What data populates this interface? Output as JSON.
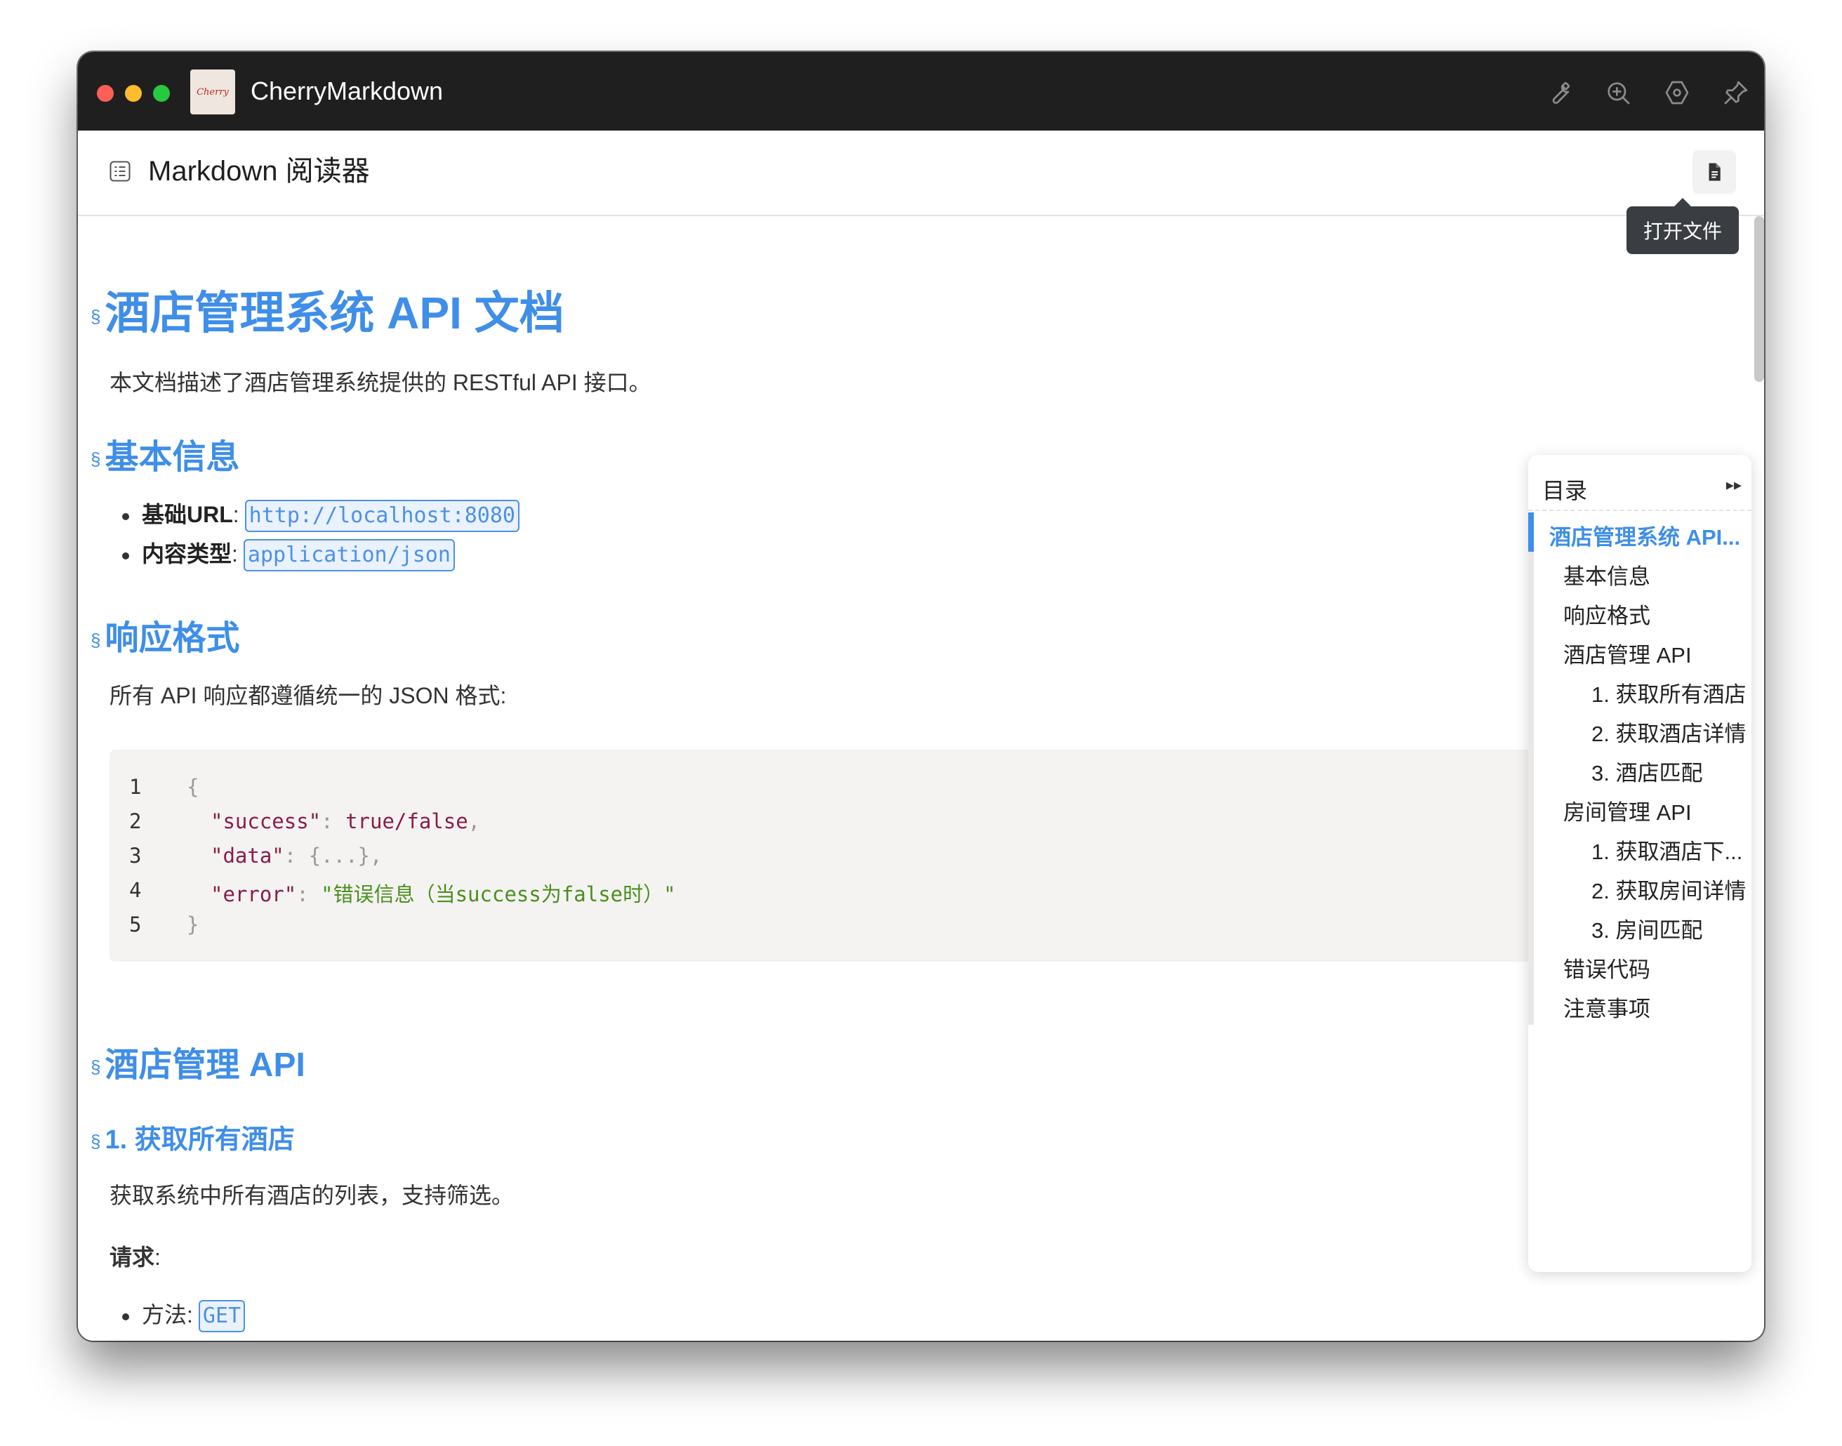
{
  "window": {
    "app_title": "CherryMarkdown",
    "app_icon_text": "Cherry"
  },
  "titlebar_icons": [
    "wrench-icon",
    "zoom-in-icon",
    "settings-hex-icon",
    "pin-icon"
  ],
  "toolbar": {
    "title": "Markdown 阅读器",
    "open_tooltip": "打开文件"
  },
  "doc": {
    "h1": "酒店管理系统 API 文档",
    "intro": "本文档描述了酒店管理系统提供的 RESTful API 接口。",
    "h2_basic": "基本信息",
    "basic_items": [
      {
        "label": "基础URL",
        "colon": ":",
        "code": "http://localhost:8080"
      },
      {
        "label": "内容类型",
        "colon": ":",
        "code": "application/json"
      }
    ],
    "h2_response": "响应格式",
    "response_intro": "所有 API 响应都遵循统一的 JSON 格式:",
    "code_lines": [
      {
        "n": "1",
        "punct_open": "{"
      },
      {
        "n": "2",
        "key": "\"success\"",
        "sep": ": ",
        "val": "true/false",
        "tail": ","
      },
      {
        "n": "3",
        "key": "\"data\"",
        "sep": ": ",
        "val": "{...}",
        "tail": ","
      },
      {
        "n": "4",
        "key": "\"error\"",
        "sep": ": ",
        "val": "\"错误信息（当success为false时）\""
      },
      {
        "n": "5",
        "punct_open": "}"
      }
    ],
    "h2_hotel": "酒店管理 API",
    "h3_get_all": "1. 获取所有酒店",
    "get_all_desc": "获取系统中所有酒店的列表，支持筛选。",
    "request_label": "请求",
    "request_colon": ":",
    "method_label": "方法:",
    "method_value": "GET",
    "anchor": "§"
  },
  "toc": {
    "title": "目录",
    "toggle": "▸▸",
    "items": [
      {
        "label": "酒店管理系统 API...",
        "level": 1,
        "active": true
      },
      {
        "label": "基本信息",
        "level": 2
      },
      {
        "label": "响应格式",
        "level": 2
      },
      {
        "label": "酒店管理 API",
        "level": 2
      },
      {
        "label": "1. 获取所有酒店",
        "level": 3
      },
      {
        "label": "2. 获取酒店详情",
        "level": 3
      },
      {
        "label": "3. 酒店匹配",
        "level": 3
      },
      {
        "label": "房间管理 API",
        "level": 2
      },
      {
        "label": "1. 获取酒店下...",
        "level": 3
      },
      {
        "label": "2. 获取房间详情",
        "level": 3
      },
      {
        "label": "3. 房间匹配",
        "level": 3
      },
      {
        "label": "错误代码",
        "level": 2
      },
      {
        "label": "注意事项",
        "level": 2
      }
    ]
  },
  "colors": {
    "accent": "#3f8ee8",
    "titlebar": "#1f1f1f",
    "code_bg": "#f4f3f2",
    "code_key": "#8a1b4a",
    "code_string": "#4a8f1d"
  }
}
